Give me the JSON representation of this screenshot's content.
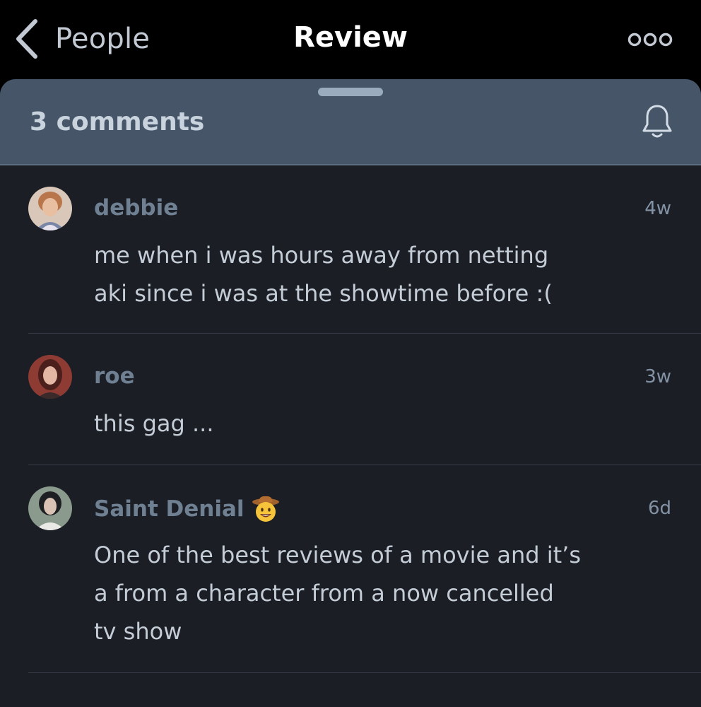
{
  "navbar": {
    "back_label": "People",
    "title": "Review",
    "back_icon": "chevron-left-icon",
    "more_icon": "ellipsis-icon"
  },
  "sheet": {
    "comment_count": "3 comments",
    "bell_icon": "bell-icon"
  },
  "comments": [
    {
      "author": "debbie",
      "time": "4w",
      "text": "me when i was hours away from netting\naki since i was at the showtime before :("
    },
    {
      "author": "roe",
      "time": "3w",
      "text": "this gag ..."
    },
    {
      "author": "Saint Denial",
      "author_emoji": "cowboy-face-emoji",
      "time": "6d",
      "text": "One of the best reviews of a movie and it’s\na from a character from a now cancelled\ntv show"
    }
  ],
  "colors": {
    "background": "#000000",
    "sheet": "#1b1e25",
    "sheet_header": "#465668",
    "author": "#6f8093",
    "body_text": "#c4ccd6",
    "title": "#ffffff"
  }
}
